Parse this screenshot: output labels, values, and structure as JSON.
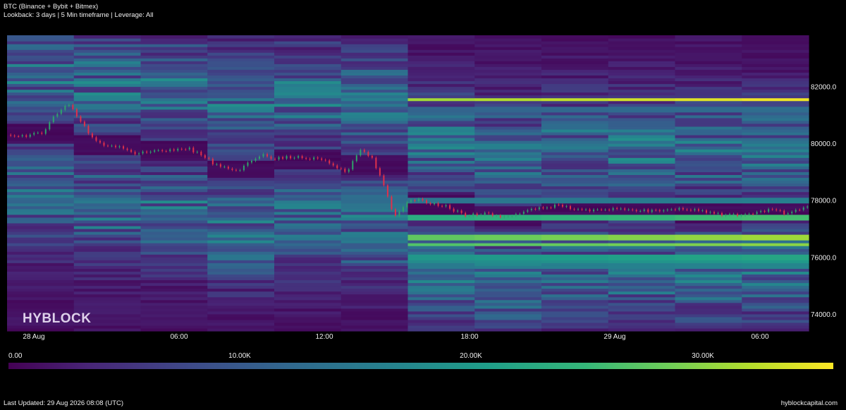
{
  "header": {
    "title": "BTC (Binance + Bybit + Bitmex)",
    "subtitle": "Lookback: 3 days | 5 Min timeframe | Leverage: All"
  },
  "watermark": "HYBLOCK",
  "colors": {
    "background": "#000000",
    "heat_low": "#440154",
    "heat_mid": "#21918c",
    "heat_high": "#fde725",
    "candle_up": "#2fa36b",
    "candle_down": "#e0314b"
  },
  "chart_data": {
    "type": "heatmap",
    "title": "BTC (Binance + Bybit + Bitmex)",
    "x_ticks": [
      "28 Aug",
      "06:00",
      "12:00",
      "18:00",
      "29 Aug",
      "06:00"
    ],
    "y_ticks": [
      "74000.0",
      "76000.0",
      "78000.0",
      "80000.0",
      "82000.0"
    ],
    "y_tick_values": [
      74000,
      76000,
      78000,
      80000,
      82000
    ],
    "ylim": [
      73400,
      83800
    ],
    "xlim_hours": [
      0,
      33
    ],
    "colorscale": "viridis",
    "colorbar": {
      "min": 0,
      "max": 35000,
      "tick_labels": [
        "0.00",
        "10.00K",
        "20.00K",
        "30.00K"
      ],
      "tick_values": [
        0,
        10000,
        20000,
        30000
      ]
    },
    "price_series_hours": [
      0,
      0.5,
      1,
      1.5,
      2,
      2.5,
      3,
      3.5,
      4,
      4.5,
      5,
      5.5,
      6,
      6.5,
      7,
      7.5,
      8,
      8.5,
      9,
      9.5,
      10,
      10.5,
      11,
      11.5,
      12,
      12.5,
      13,
      13.5,
      14,
      14.5,
      15,
      15.5,
      15.8,
      16,
      16.5,
      17,
      17.5,
      18,
      18.5,
      19,
      19.5,
      20,
      20.5,
      21,
      21.5,
      22,
      22.5,
      23,
      23.5,
      24,
      24.5,
      25,
      25.5,
      26,
      26.5,
      27,
      27.5,
      28,
      28.5,
      29,
      29.5,
      30,
      30.5,
      31,
      31.5,
      32,
      32.5,
      33
    ],
    "price_series_values": [
      80300,
      80250,
      80300,
      80400,
      81000,
      81450,
      80800,
      80200,
      79950,
      79900,
      79700,
      79650,
      79700,
      79700,
      79780,
      79800,
      79600,
      79300,
      79150,
      79000,
      79400,
      79600,
      79450,
      79500,
      79500,
      79450,
      79450,
      79200,
      78950,
      79800,
      79500,
      78600,
      77800,
      77400,
      77950,
      78000,
      77900,
      77800,
      77600,
      77450,
      77550,
      77450,
      77400,
      77500,
      77650,
      77700,
      77800,
      77750,
      77700,
      77600,
      77650,
      77700,
      77680,
      77650,
      77600,
      77650,
      77700,
      77700,
      77650,
      77550,
      77500,
      77500,
      77520,
      77600,
      77650,
      77550,
      77650,
      77750
    ],
    "liquidation_levels_usd": [
      {
        "price": 81550,
        "value": 35000
      },
      {
        "price": 81200,
        "value": 13000
      },
      {
        "price": 77400,
        "value": 26000
      },
      {
        "price": 76700,
        "value": 31000
      },
      {
        "price": 76450,
        "value": 30000
      },
      {
        "price": 76000,
        "value": 22000
      },
      {
        "price": 75900,
        "value": 20000
      },
      {
        "price": 75700,
        "value": 17000
      },
      {
        "price": 78000,
        "value": 16000
      },
      {
        "price": 80050,
        "value": 14000
      },
      {
        "price": 80400,
        "value": 12000
      }
    ]
  },
  "footer": {
    "left": "Last Updated: 29 Aug 2026 08:08 (UTC)",
    "right": "hyblockcapital.com"
  }
}
